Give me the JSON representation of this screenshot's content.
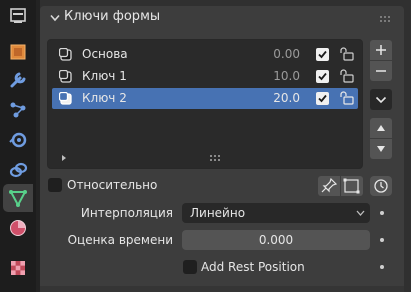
{
  "panel": {
    "title": "Ключи формы"
  },
  "shape_keys": [
    {
      "name": "Основа",
      "value": "0.00",
      "selected": false
    },
    {
      "name": "Ключ 1",
      "value": "10.0",
      "selected": false
    },
    {
      "name": "Ключ 2",
      "value": "20.0",
      "selected": true
    }
  ],
  "options": {
    "relative_label": "Относительно",
    "interpolation_label": "Интерполяция",
    "interpolation_value": "Линейно",
    "eval_time_label": "Оценка времени",
    "eval_time_value": "0.000",
    "add_rest_label": "Add Rest Position"
  },
  "colors": {
    "selection": "#4772b3",
    "panel": "#3d3d3d",
    "list_bg": "#2a2a2a"
  },
  "tabs": [
    "output-icon",
    "object-icon",
    "modifier-icon",
    "particles-icon",
    "physics-icon",
    "constraints-icon",
    "object-data-icon",
    "material-icon",
    "texture-icon"
  ]
}
